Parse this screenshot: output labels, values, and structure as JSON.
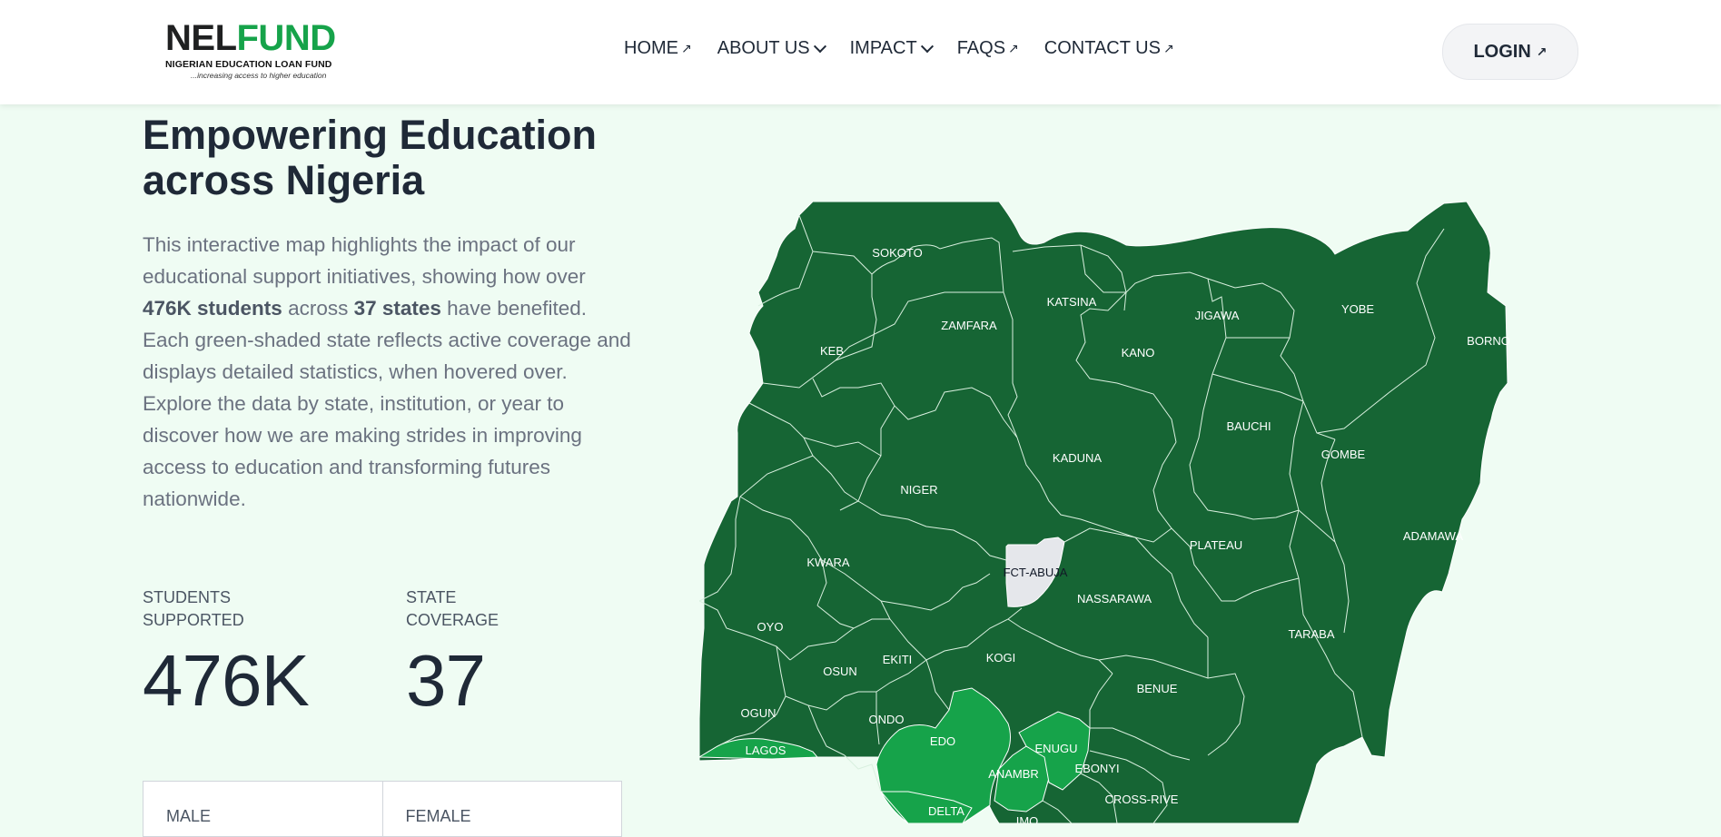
{
  "header": {
    "logo": {
      "word_a": "NEL",
      "word_b": "FUND",
      "subtitle": "NIGERIAN EDUCATION LOAN FUND",
      "tagline": "...increasing access to higher education"
    },
    "nav": [
      {
        "label": "HOME",
        "icon": "arrow-up-right-icon"
      },
      {
        "label": "ABOUT US",
        "icon": "chevron-down-icon"
      },
      {
        "label": "IMPACT",
        "icon": "chevron-down-icon"
      },
      {
        "label": "FAQS",
        "icon": "arrow-up-right-icon"
      },
      {
        "label": "CONTACT US",
        "icon": "arrow-up-right-icon"
      }
    ],
    "login_label": "LOGIN"
  },
  "hero": {
    "title": "Empowering Education across Nigeria",
    "desc_1": "This interactive map highlights the impact of our educational support initiatives, showing how over ",
    "desc_students": "476K students",
    "desc_2": " across ",
    "desc_states": "37 states",
    "desc_3": " have benefited. Each green-shaded state reflects active coverage and displays detailed statistics, when hovered over. Explore the data by state, institution, or year to discover how we are making strides in improving access to education and transforming futures nationwide."
  },
  "stats": {
    "students_label": "STUDENTS SUPPORTED",
    "students_value": "476K",
    "states_label": "STATE COVERAGE",
    "states_value": "37"
  },
  "gender": {
    "male_label": "MALE",
    "female_label": "FEMALE"
  },
  "map": {
    "colors": {
      "active": "#166534",
      "highlight": "#16a34a",
      "fct": "#e5e7eb",
      "border": "#ffffff"
    },
    "states": {
      "sokoto": "SOKOTO",
      "zamfara": "ZAMFARA",
      "katsina": "KATSINA",
      "jigawa": "JIGAWA",
      "yobe": "YOBE",
      "borno": "BORNO",
      "kebbi": "KEB",
      "kano": "KANO",
      "bauchi": "BAUCHI",
      "gombe": "GOMBE",
      "kaduna": "KADUNA",
      "niger": "NIGER",
      "plateau": "PLATEAU",
      "adamawa": "ADAMAWA",
      "kwara": "KWARA",
      "fct": "FCT-ABUJA",
      "nassarawa": "NASSARAWA",
      "oyo": "OYO",
      "taraba": "TARABA",
      "osun": "OSUN",
      "ekiti": "EKITI",
      "kogi": "KOGI",
      "benue": "BENUE",
      "ogun": "OGUN",
      "ondo": "ONDO",
      "edo": "EDO",
      "enugu": "ENUGU",
      "lagos": "LAGOS",
      "anambra": "ANAMBR",
      "ebonyi": "EBONYI",
      "delta": "DELTA",
      "cross_river": "CROSS-RIVE",
      "imo": "IMO"
    }
  }
}
